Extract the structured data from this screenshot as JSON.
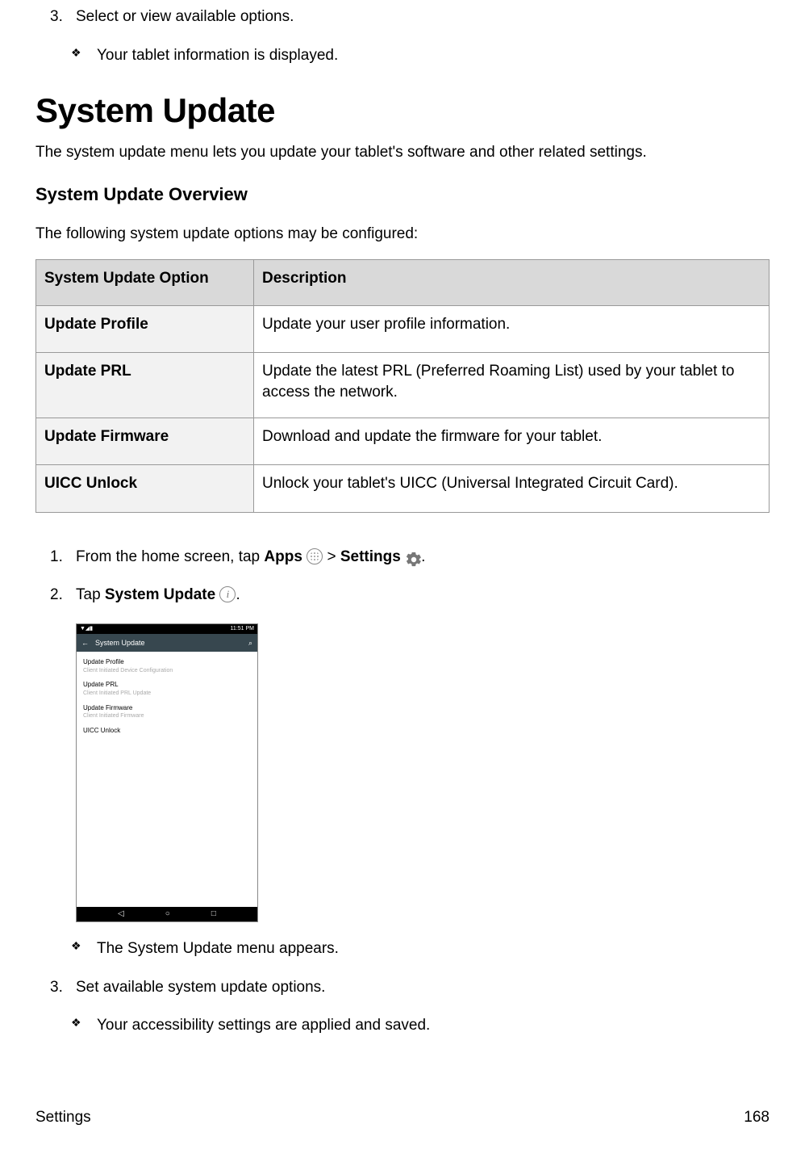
{
  "top_step": {
    "num": "3.",
    "text": "Select or view available options."
  },
  "top_result": "Your tablet information is displayed.",
  "h1": "System Update",
  "intro": "The system update menu lets you update your tablet's software and other related settings.",
  "h2": "System Update Overview",
  "following": "The following system update options may be configured:",
  "table": {
    "head": [
      "System Update Option",
      "Description"
    ],
    "rows": [
      [
        "Update Profile",
        "Update your user profile information."
      ],
      [
        "Update PRL",
        "Update the latest PRL (Preferred Roaming List) used by your tablet to access the network."
      ],
      [
        "Update Firmware",
        "Download and update the firmware for your tablet."
      ],
      [
        "UICC Unlock",
        "Unlock your tablet's UICC (Universal Integrated Circuit Card)."
      ]
    ]
  },
  "steps": {
    "s1": {
      "num": "1.",
      "pre": "From the home screen, tap ",
      "apps": "Apps",
      "gt": " > ",
      "settings": "Settings",
      "post": "."
    },
    "s2": {
      "num": "2.",
      "pre": "Tap ",
      "bold": "System Update",
      "post": "."
    },
    "s3": {
      "num": "3.",
      "text": "Set available system update options."
    }
  },
  "screenshot": {
    "status_left": "▼◢▮",
    "status_right": "11:51 PM",
    "back": "←",
    "title": "System Update",
    "search": "⌕",
    "rows": [
      {
        "t": "Update Profile",
        "s": "Client Initiated Device Configuration"
      },
      {
        "t": "Update PRL",
        "s": "Client Initiated PRL Update"
      },
      {
        "t": "Update Firmware",
        "s": "Client Initiated Firmware"
      },
      {
        "t": "UICC Unlock",
        "s": ""
      }
    ],
    "nav": [
      "◁",
      "○",
      "□"
    ]
  },
  "result2": "The System Update menu appears.",
  "result3": "Your accessibility settings are applied and saved.",
  "footer": {
    "left": "Settings",
    "right": "168"
  },
  "bullet": "❖"
}
